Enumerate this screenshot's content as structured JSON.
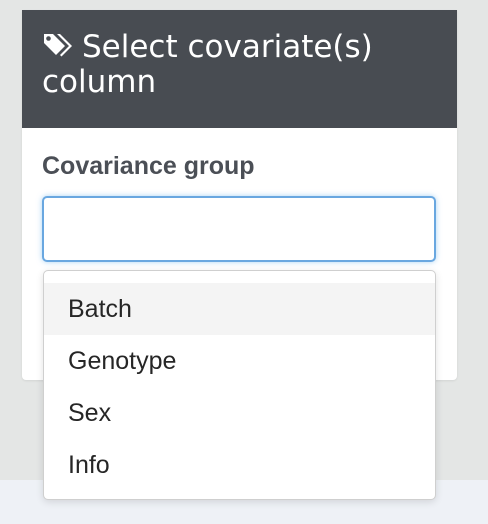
{
  "panel": {
    "title": "Select covariate(s) column",
    "icon": "tags-icon",
    "header_color": "#484c52"
  },
  "form": {
    "label": "Covariance group",
    "input_value": "",
    "input_focus_color": "#69a7e0"
  },
  "dropdown": {
    "options": [
      {
        "label": "Batch",
        "highlighted": true
      },
      {
        "label": "Genotype",
        "highlighted": false
      },
      {
        "label": "Sex",
        "highlighted": false
      },
      {
        "label": "Info",
        "highlighted": false
      }
    ]
  }
}
